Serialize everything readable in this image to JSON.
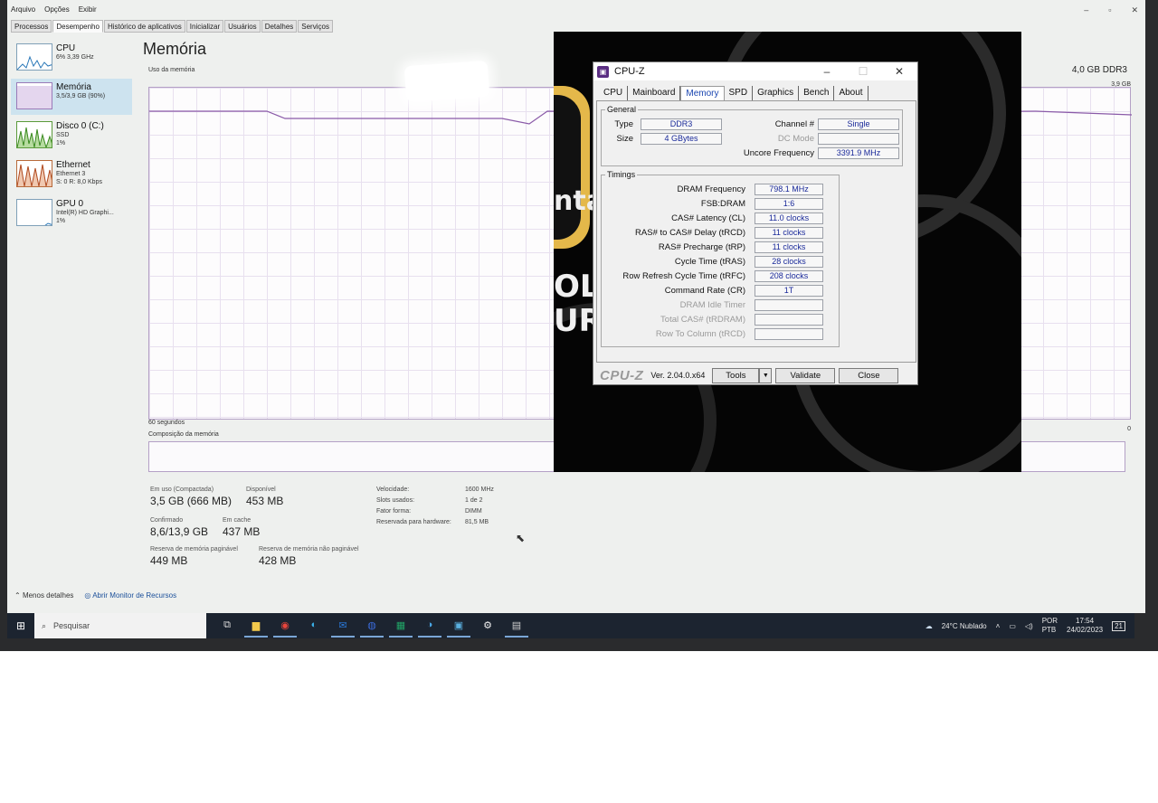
{
  "task_manager": {
    "menu": [
      "Arquivo",
      "Opções",
      "Exibir"
    ],
    "tabs": [
      "Processos",
      "Desempenho",
      "Histórico de aplicativos",
      "Inicializar",
      "Usuários",
      "Detalhes",
      "Serviços"
    ],
    "active_tab": "Desempenho",
    "sidebar": [
      {
        "name": "CPU",
        "sub1": "6% 3,39 GHz",
        "sub2": ""
      },
      {
        "name": "Memória",
        "sub1": "3,5/3,9 GB (90%)",
        "sub2": ""
      },
      {
        "name": "Disco 0 (C:)",
        "sub1": "SSD",
        "sub2": "1%"
      },
      {
        "name": "Ethernet",
        "sub1": "Ethernet 3",
        "sub2": "S: 0 R: 8,0 Kbps"
      },
      {
        "name": "GPU 0",
        "sub1": "Intel(R) HD Graphi...",
        "sub2": "1%"
      }
    ],
    "title": "Memória",
    "memory_type": "4,0 GB DDR3",
    "graph_label": "Uso da memória",
    "graph_max": "3,9 GB",
    "graph_time": "60 segundos",
    "graph_zero": "0",
    "composition_label": "Composição da memória",
    "stats": {
      "in_use_label": "Em uso (Compactada)",
      "in_use_value": "3,5 GB (666 MB)",
      "available_label": "Disponível",
      "available_value": "453 MB",
      "committed_label": "Confirmado",
      "committed_value": "8,6/13,9 GB",
      "cached_label": "Em cache",
      "cached_value": "437 MB",
      "paged_label": "Reserva de memória paginável",
      "paged_value": "449 MB",
      "nonpaged_label": "Reserva de memória não paginável",
      "nonpaged_value": "428 MB"
    },
    "details": {
      "speed_label": "Velocidade:",
      "speed_value": "1600 MHz",
      "slots_label": "Slots usados:",
      "slots_value": "1 de 2",
      "form_label": "Fator forma:",
      "form_value": "DIMM",
      "reserved_label": "Reservada para hardware:",
      "reserved_value": "81,5 MB"
    },
    "footer": {
      "less_details": "Menos detalhes",
      "resource_monitor": "Abrir Monitor de Recursos"
    }
  },
  "taskbar": {
    "search_placeholder": "Pesquisar",
    "weather": "24°C Nublado",
    "lang1": "POR",
    "lang2": "PTB",
    "time": "17:54",
    "date": "24/02/2023",
    "notifications": "21"
  },
  "cpuz": {
    "title": "CPU-Z",
    "tabs": [
      "CPU",
      "Mainboard",
      "Memory",
      "SPD",
      "Graphics",
      "Bench",
      "About"
    ],
    "active_tab": "Memory",
    "general_legend": "General",
    "type_label": "Type",
    "type_value": "DDR3",
    "size_label": "Size",
    "size_value": "4 GBytes",
    "channel_label": "Channel #",
    "channel_value": "Single",
    "dcmode_label": "DC Mode",
    "dcmode_value": "",
    "uncore_label": "Uncore Frequency",
    "uncore_value": "3391.9 MHz",
    "timings_legend": "Timings",
    "timings": [
      {
        "label": "DRAM Frequency",
        "value": "798.1 MHz",
        "enabled": true
      },
      {
        "label": "FSB:DRAM",
        "value": "1:6",
        "enabled": true
      },
      {
        "label": "CAS# Latency (CL)",
        "value": "11.0 clocks",
        "enabled": true
      },
      {
        "label": "RAS# to CAS# Delay (tRCD)",
        "value": "11 clocks",
        "enabled": true
      },
      {
        "label": "RAS# Precharge (tRP)",
        "value": "11 clocks",
        "enabled": true
      },
      {
        "label": "Cycle Time (tRAS)",
        "value": "28 clocks",
        "enabled": true
      },
      {
        "label": "Row Refresh Cycle Time (tRFC)",
        "value": "208 clocks",
        "enabled": true
      },
      {
        "label": "Command Rate (CR)",
        "value": "1T",
        "enabled": true
      },
      {
        "label": "DRAM Idle Timer",
        "value": "",
        "enabled": false
      },
      {
        "label": "Total CAS# (tRDRAM)",
        "value": "",
        "enabled": false
      },
      {
        "label": "Row To Column (tRCD)",
        "value": "",
        "enabled": false
      }
    ],
    "brand": "CPU-Z",
    "version": "Ver. 2.04.0.x64",
    "tools_label": "Tools",
    "validate_label": "Validate",
    "close_label": "Close"
  },
  "poster": {
    "text1": "nta",
    "text2": "OL",
    "text3": "UR"
  }
}
